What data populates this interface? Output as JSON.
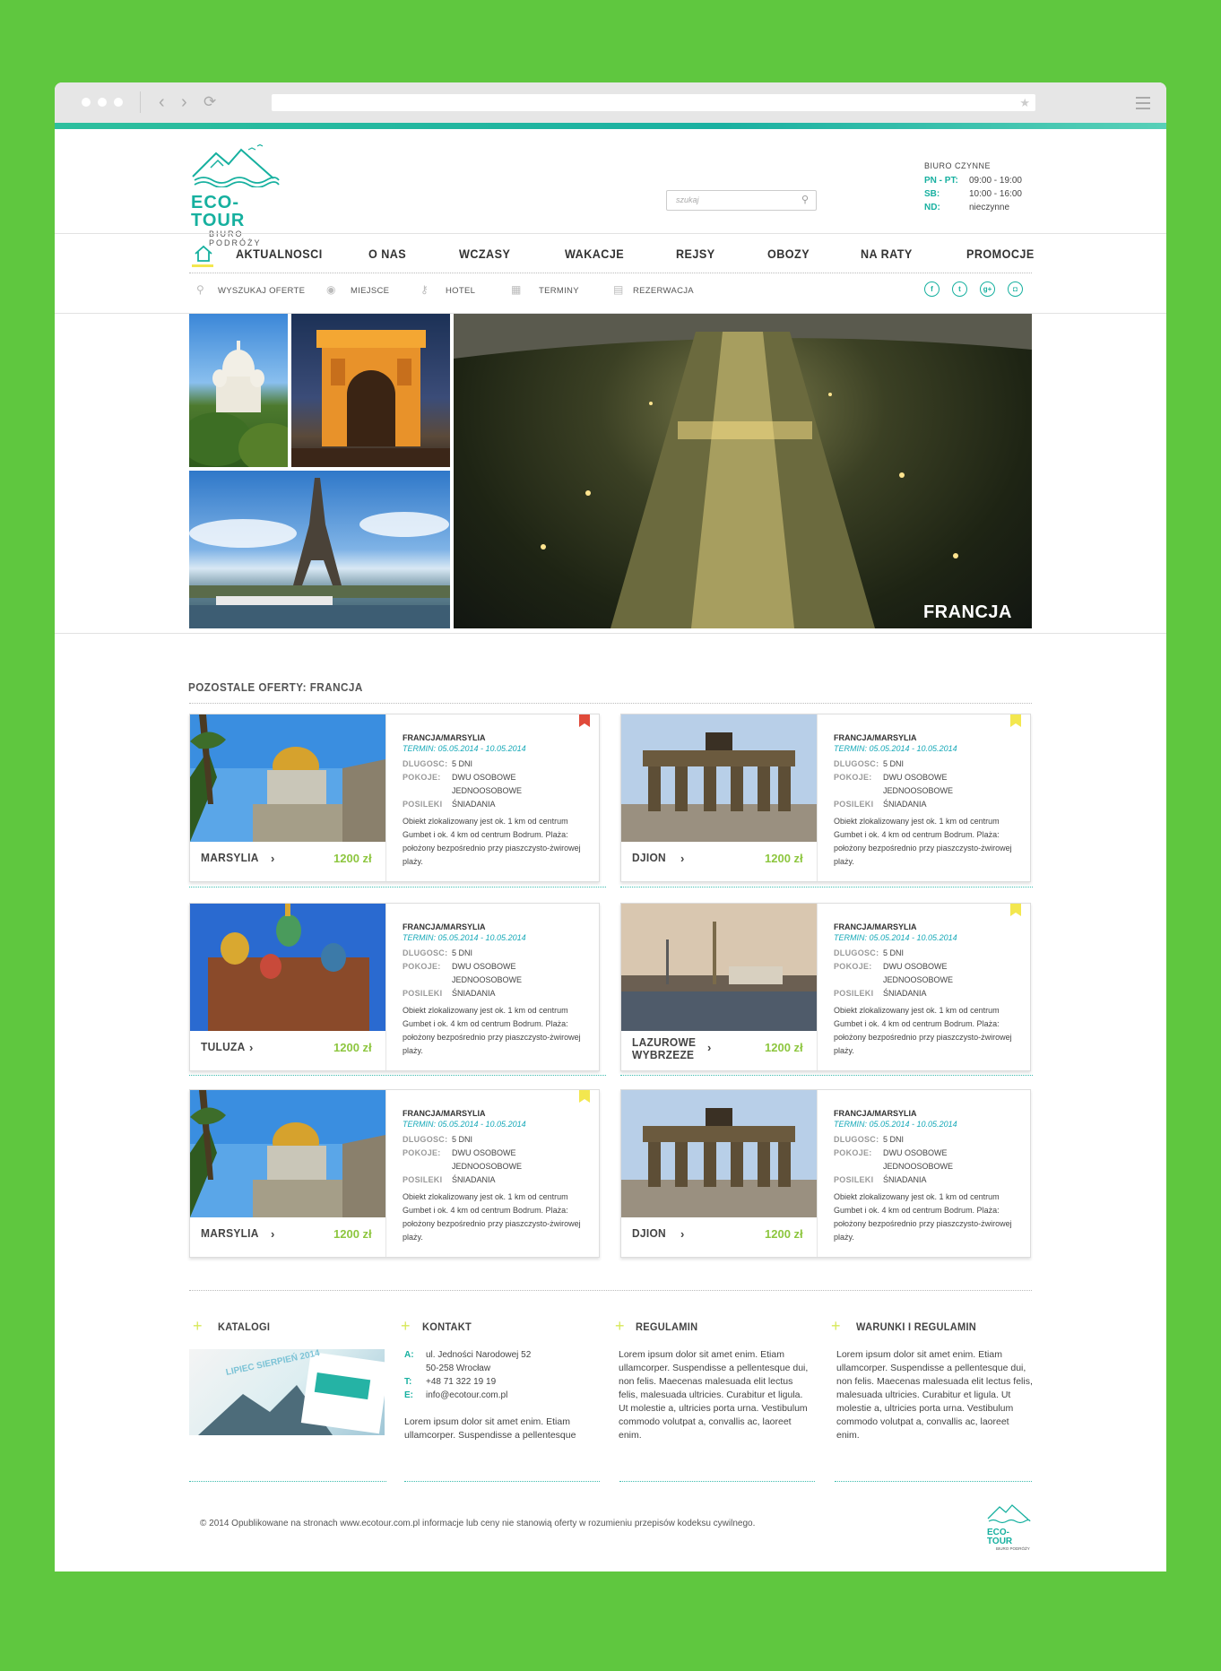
{
  "browser": {
    "icons": [
      "circle-icon",
      "back-icon",
      "forward-icon",
      "reload-icon",
      "star-icon",
      "menu-icon"
    ]
  },
  "brand": {
    "name": "ECO-TOUR",
    "tagline": "BIURO PODRÓŻY"
  },
  "search": {
    "placeholder": "szukaj"
  },
  "office": {
    "title": "BIURO CZYNNE",
    "rows": [
      {
        "label": "PN - PT:",
        "value": "09:00 - 19:00"
      },
      {
        "label": "SB:",
        "value": "10:00 - 16:00"
      },
      {
        "label": "ND:",
        "value": "nieczynne"
      }
    ]
  },
  "menu": [
    "AKTUALNOSCI",
    "O NAS",
    "WCZASY",
    "WAKACJE",
    "REJSY",
    "OBOZY",
    "NA RATY",
    "PROMOCJE"
  ],
  "submenu": [
    "WYSZUKAJ OFERTE",
    "MIEJSCE",
    "HOTEL",
    "TERMINY",
    "REZERWACJA"
  ],
  "social": [
    "facebook-icon",
    "twitter-icon",
    "google-plus-icon",
    "instagram-icon"
  ],
  "hero": {
    "caption": "FRANCJA"
  },
  "section_title": "POZOSTALE OFERTY: FRANCJA",
  "offer_labels": {
    "duration": "DLUGOSC:",
    "rooms": "POKOJE:",
    "meals": "POSILEKI"
  },
  "offers": [
    {
      "name": "MARSYLIA",
      "price": "1200 zł",
      "title": "FRANCJA/MARSYLIA",
      "term": "TERMIN: 05.05.2014 - 10.05.2014",
      "duration": "5 DNI",
      "room1": "DWU OSOBOWE",
      "room2": "JEDNOOSOBOWE",
      "meals": "ŚNIADANIA",
      "desc": "Obiekt zlokalizowany jest ok. 1 km od centrum Gumbet i ok. 4 km od centrum Bodrum. Plaża: położony bezpośrednio przy piaszczysto-żwirowej plaży.",
      "badge": "red",
      "photo": "dome"
    },
    {
      "name": "DJION",
      "price": "1200 zł",
      "title": "FRANCJA/MARSYLIA",
      "term": "TERMIN: 05.05.2014 - 10.05.2014",
      "duration": "5 DNI",
      "room1": "DWU OSOBOWE",
      "room2": "JEDNOOSOBOWE",
      "meals": "ŚNIADANIA",
      "desc": "Obiekt zlokalizowany jest ok. 1 km od centrum Gumbet i ok. 4 km od centrum Bodrum. Plaża: położony bezpośrednio przy piaszczysto-żwirowej plaży.",
      "badge": "yellow",
      "photo": "gate"
    },
    {
      "name": "TULUZA",
      "price": "1200 zł",
      "title": "FRANCJA/MARSYLIA",
      "term": "TERMIN: 05.05.2014 - 10.05.2014",
      "duration": "5 DNI",
      "room1": "DWU OSOBOWE",
      "room2": "JEDNOOSOBOWE",
      "meals": "ŚNIADANIA",
      "desc": "Obiekt zlokalizowany jest ok. 1 km od centrum Gumbet i ok. 4 km od centrum Bodrum. Plaża: położony bezpośrednio przy piaszczysto-żwirowej plaży.",
      "badge": "",
      "photo": "church"
    },
    {
      "name": "LAZUROWE WYBRZEZE",
      "price": "1200 zł",
      "title": "FRANCJA/MARSYLIA",
      "term": "TERMIN: 05.05.2014 - 10.05.2014",
      "duration": "5 DNI",
      "room1": "DWU OSOBOWE",
      "room2": "JEDNOOSOBOWE",
      "meals": "ŚNIADANIA",
      "desc": "Obiekt zlokalizowany jest ok. 1 km od centrum Gumbet i ok. 4 km od centrum Bodrum. Plaża: położony bezpośrednio przy piaszczysto-żwirowej plaży.",
      "badge": "yellow",
      "photo": "city"
    },
    {
      "name": "MARSYLIA",
      "price": "1200 zł",
      "title": "FRANCJA/MARSYLIA",
      "term": "TERMIN: 05.05.2014 - 10.05.2014",
      "duration": "5 DNI",
      "room1": "DWU OSOBOWE",
      "room2": "JEDNOOSOBOWE",
      "meals": "ŚNIADANIA",
      "desc": "Obiekt zlokalizowany jest ok. 1 km od centrum Gumbet i ok. 4 km od centrum Bodrum. Plaża: położony bezpośrednio przy piaszczysto-żwirowej plaży.",
      "badge": "yellow",
      "photo": "dome"
    },
    {
      "name": "DJION",
      "price": "1200 zł",
      "title": "FRANCJA/MARSYLIA",
      "term": "TERMIN: 05.05.2014 - 10.05.2014",
      "duration": "5 DNI",
      "room1": "DWU OSOBOWE",
      "room2": "JEDNOOSOBOWE",
      "meals": "ŚNIADANIA",
      "desc": "Obiekt zlokalizowany jest ok. 1 km od centrum Gumbet i ok. 4 km od centrum Bodrum. Plaża: położony bezpośrednio przy piaszczysto-żwirowej plaży.",
      "badge": "",
      "photo": "gate"
    }
  ],
  "footer": {
    "catalogs": {
      "title": "KATALOGI",
      "cover": "LIPIEC SIERPIEŃ 2014"
    },
    "contact": {
      "title": "KONTAKT",
      "rows": [
        {
          "label": "A:",
          "value": "ul. Jedności Narodowej 52"
        },
        {
          "label": "",
          "value": "50-258 Wrocław"
        },
        {
          "label": "T:",
          "value": "+48 71 322 19 19"
        },
        {
          "label": "E:",
          "value": "info@ecotour.com.pl"
        }
      ],
      "text": "Lorem ipsum dolor sit amet enim. Etiam ullamcorper. Suspendisse a pellentesque"
    },
    "rules": {
      "title": "REGULAMIN",
      "text": "Lorem ipsum dolor sit amet enim. Etiam ullamcorper. Suspendisse a pellentesque dui, non felis. Maecenas malesuada elit lectus felis, malesuada ultricies. Curabitur et ligula. Ut molestie a, ultricies porta urna. Vestibulum commodo volutpat a, convallis ac, laoreet enim."
    },
    "terms": {
      "title": "WARUNKI I REGULAMIN",
      "text": "Lorem ipsum dolor sit amet enim. Etiam ullamcorper. Suspendisse a pellentesque dui, non felis. Maecenas malesuada elit lectus felis, malesuada ultricies. Curabitur et ligula. Ut molestie a, ultricies porta urna. Vestibulum commodo volutpat a, convallis ac, laoreet enim."
    },
    "copyright": "© 2014     Opublikowane na stronach www.ecotour.com.pl informacje lub ceny nie stanowią oferty w rozumieniu przepisów kodeksu cywilnego."
  },
  "colors": {
    "background": "#5fc73f",
    "accent": "#17b0a0",
    "price": "#8dc63f"
  }
}
